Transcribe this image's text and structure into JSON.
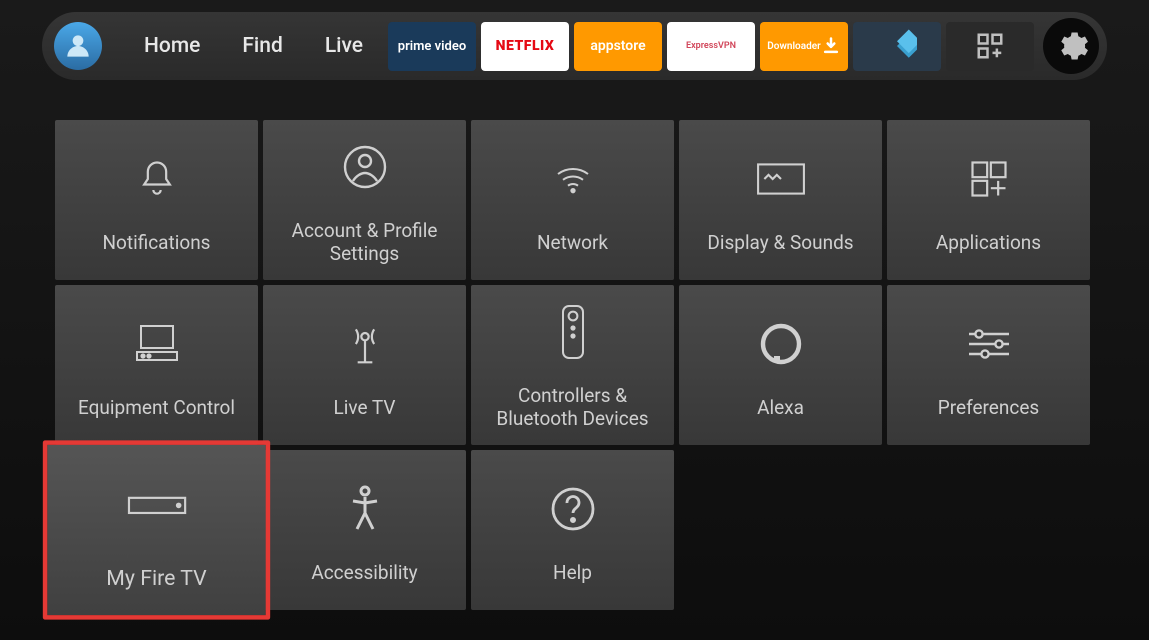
{
  "nav": {
    "home": "Home",
    "find": "Find",
    "live": "Live"
  },
  "apps": {
    "prime": "prime video",
    "netflix": "NETFLIX",
    "appstore": "appstore",
    "express": "ExpressVPN",
    "downloader": "Downloader"
  },
  "tiles": {
    "notifications": "Notifications",
    "account": "Account & Profile Settings",
    "network": "Network",
    "display": "Display & Sounds",
    "applications": "Applications",
    "equipment": "Equipment Control",
    "livetv": "Live TV",
    "controllers": "Controllers & Bluetooth Devices",
    "alexa": "Alexa",
    "preferences": "Preferences",
    "myfiretv": "My Fire TV",
    "accessibility": "Accessibility",
    "help": "Help"
  },
  "selected_tile": "myfiretv"
}
